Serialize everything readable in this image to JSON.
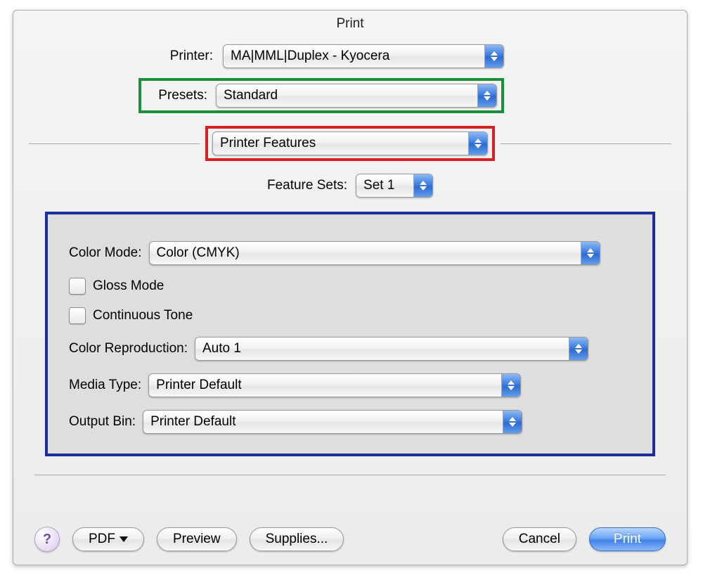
{
  "window": {
    "title": "Print"
  },
  "printer": {
    "label": "Printer:",
    "value": "MA|MML|Duplex - Kyocera"
  },
  "presets": {
    "label": "Presets:",
    "value": "Standard"
  },
  "section_popup": {
    "value": "Printer Features"
  },
  "feature_sets": {
    "label": "Feature Sets:",
    "value": "Set 1"
  },
  "panel": {
    "color_mode": {
      "label": "Color Mode:",
      "value": "Color (CMYK)"
    },
    "gloss_mode": {
      "label": "Gloss Mode",
      "checked": false
    },
    "continuous_tone": {
      "label": "Continuous Tone",
      "checked": false
    },
    "color_reproduction": {
      "label": "Color Reproduction:",
      "value": "Auto 1"
    },
    "media_type": {
      "label": "Media Type:",
      "value": "Printer Default"
    },
    "output_bin": {
      "label": "Output Bin:",
      "value": "Printer Default"
    }
  },
  "buttons": {
    "help": "?",
    "pdf": "PDF",
    "preview": "Preview",
    "supplies": "Supplies...",
    "cancel": "Cancel",
    "print": "Print"
  }
}
